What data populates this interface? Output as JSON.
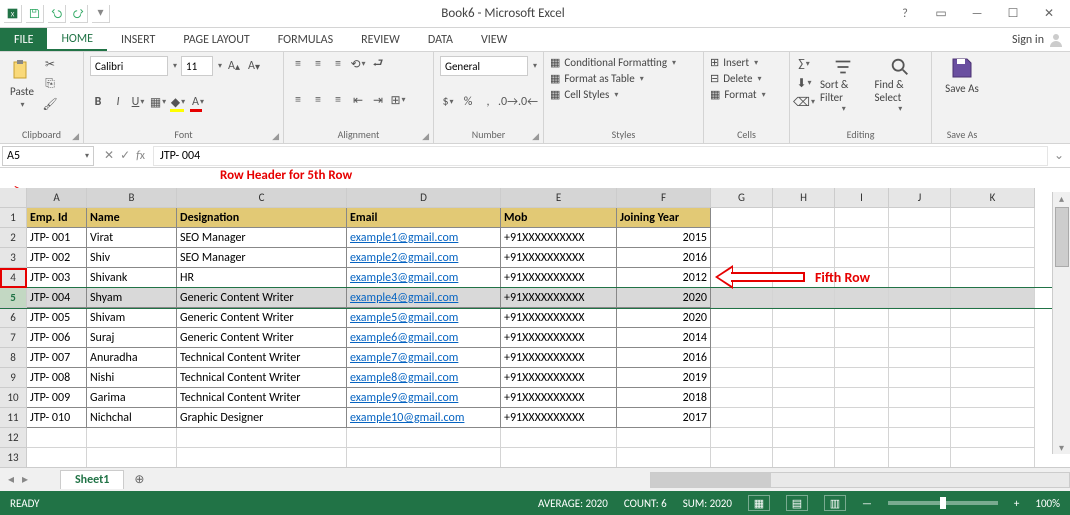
{
  "chart_data": {
    "type": "table",
    "columns": [
      "Emp. Id",
      "Name",
      "Designation",
      "Email",
      "Mob",
      "Joining Year"
    ],
    "rows": [
      [
        "JTP- 001",
        "Virat",
        "SEO Manager",
        "example1@gmail.com",
        "+91XXXXXXXXXX",
        2015
      ],
      [
        "JTP- 002",
        "Shiv",
        "SEO Manager",
        "example2@gmail.com",
        "+91XXXXXXXXXX",
        2016
      ],
      [
        "JTP- 003",
        "Shivank",
        "HR",
        "example3@gmail.com",
        "+91XXXXXXXXXX",
        2012
      ],
      [
        "JTP- 004",
        "Shyam",
        "Generic Content Writer",
        "example4@gmail.com",
        "+91XXXXXXXXXX",
        2020
      ],
      [
        "JTP- 005",
        "Shivam",
        "Generic Content Writer",
        "example5@gmail.com",
        "+91XXXXXXXXXX",
        2020
      ],
      [
        "JTP- 006",
        "Suraj",
        "Generic Content Writer",
        "example6@gmail.com",
        "+91XXXXXXXXXX",
        2014
      ],
      [
        "JTP- 007",
        "Anuradha",
        "Technical Content Writer",
        "example7@gmail.com",
        "+91XXXXXXXXXX",
        2016
      ],
      [
        "JTP- 008",
        "Nishi",
        "Technical Content Writer",
        "example8@gmail.com",
        "+91XXXXXXXXXX",
        2019
      ],
      [
        "JTP- 009",
        "Garima",
        "Technical Content Writer",
        "example9@gmail.com",
        "+91XXXXXXXXXX",
        2018
      ],
      [
        "JTP- 010",
        "Nichchal",
        "Graphic Designer",
        "example10@gmail.com",
        "+91XXXXXXXXXX",
        2017
      ]
    ]
  },
  "title": "Book6 - Microsoft Excel",
  "tabs": {
    "file": "FILE",
    "home": "HOME",
    "insert": "INSERT",
    "page": "PAGE LAYOUT",
    "formulas": "FORMULAS",
    "review": "REVIEW",
    "data": "DATA",
    "view": "VIEW"
  },
  "signin": "Sign in",
  "ribbon": {
    "clipboard": {
      "paste": "Paste",
      "label": "Clipboard"
    },
    "font": {
      "name": "Calibri",
      "size": "11",
      "label": "Font"
    },
    "alignment": {
      "label": "Alignment"
    },
    "number": {
      "format": "General",
      "label": "Number"
    },
    "styles": {
      "cond": "Conditional Formatting",
      "table": "Format as Table",
      "cell": "Cell Styles",
      "label": "Styles"
    },
    "cells": {
      "insert": "Insert",
      "delete": "Delete",
      "format": "Format",
      "label": "Cells"
    },
    "editing": {
      "sort": "Sort & Filter",
      "find": "Find & Select",
      "label": "Editing"
    },
    "saveas": {
      "btn": "Save As",
      "label": "Save As"
    }
  },
  "namebox": "A5",
  "formula": "JTP- 004",
  "annot": {
    "rowheader": "Row Header for 5th Row",
    "fifth": "Fifth Row"
  },
  "cols": [
    "A",
    "B",
    "C",
    "D",
    "E",
    "F",
    "G",
    "H",
    "I",
    "J",
    "K"
  ],
  "sheet": "Sheet1",
  "status": {
    "ready": "READY",
    "avg": "AVERAGE: 2020",
    "count": "COUNT: 6",
    "sum": "SUM: 2020",
    "zoom": "100%"
  }
}
